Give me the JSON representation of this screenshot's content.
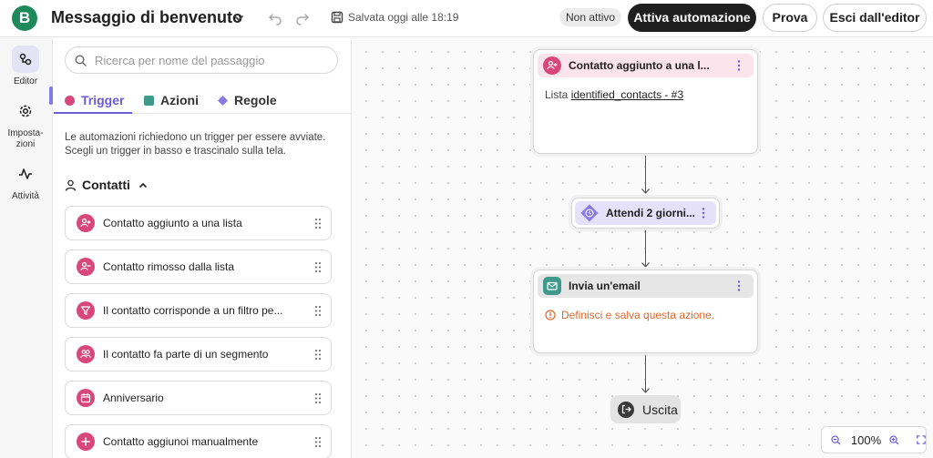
{
  "app": {
    "logo_letter": "B",
    "title": "Messaggio di benvenuto",
    "saved_text": "Salvata oggi alle 18:19",
    "status": "Non attivo",
    "activate_label": "Attiva automazione",
    "test_label": "Prova",
    "exit_editor_label": "Esci dall'editor"
  },
  "rail": {
    "items": [
      {
        "label": "Editor",
        "icon": "editor-icon",
        "active": true
      },
      {
        "label": "Imposta-\nzioni",
        "icon": "gear-icon",
        "active": false
      },
      {
        "label": "Attività",
        "icon": "activity-icon",
        "active": false
      }
    ]
  },
  "panel": {
    "search_placeholder": "Ricerca per nome del passaggio",
    "tabs": [
      {
        "label": "Trigger",
        "color": "#d9477a",
        "active": true
      },
      {
        "label": "Azioni",
        "color": "#3f9a8c",
        "active": false
      },
      {
        "label": "Regole",
        "color": "#8a7ae6",
        "active": false
      }
    ],
    "description": "Le automazioni richiedono un trigger per essere avviate. Scegli un trigger in basso e trascinalo sulla tela.",
    "section_title": "Contatti",
    "triggers": [
      {
        "label": "Contatto aggiunto a una lista",
        "icon": "user-plus-icon"
      },
      {
        "label": "Contatto rimosso dalla lista",
        "icon": "user-minus-icon"
      },
      {
        "label": "Il contatto corrisponde a un filtro pe...",
        "icon": "filter-icon"
      },
      {
        "label": "Il contatto fa parte di un segmento",
        "icon": "users-icon"
      },
      {
        "label": "Anniversario",
        "icon": "calendar-icon"
      },
      {
        "label": "Contatto aggiunoi manualmente",
        "icon": "plus-icon"
      }
    ]
  },
  "canvas": {
    "trigger_node": {
      "title": "Contatto aggiunto a una l...",
      "body_prefix": "Lista",
      "body_link": "identified_contacts - #3"
    },
    "wait_node": {
      "title": "Attendi 2 giorni..."
    },
    "email_node": {
      "title": "Invia un'email",
      "warning": "Definisci e salva questa azione."
    },
    "exit_node": {
      "label": "Uscita"
    },
    "zoom": {
      "level": "100%"
    }
  },
  "colors": {
    "brand": "#1e8a5c",
    "trigger_pink": "#d9477a",
    "action_teal": "#3f9a8c",
    "rule_purple": "#8a7ae6",
    "warning_orange": "#e0672d"
  }
}
